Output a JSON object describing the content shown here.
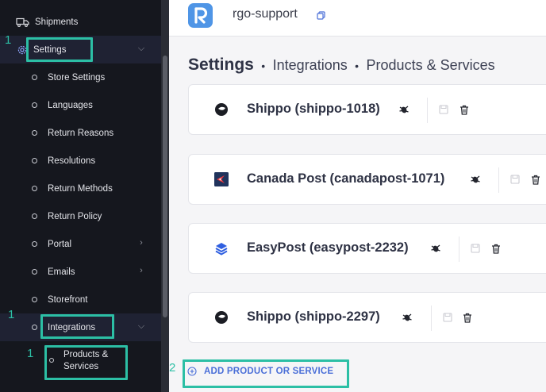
{
  "sidebar": {
    "shipments": "Shipments",
    "settings": "Settings",
    "sub_items": [
      {
        "label": "Store Settings"
      },
      {
        "label": "Languages"
      },
      {
        "label": "Return Reasons"
      },
      {
        "label": "Resolutions"
      },
      {
        "label": "Return Methods"
      },
      {
        "label": "Return Policy"
      },
      {
        "label": "Portal"
      },
      {
        "label": "Emails"
      },
      {
        "label": "Storefront"
      },
      {
        "label": "Integrations"
      }
    ],
    "products_services_line1": "Products &",
    "products_services_line2": "Services"
  },
  "annotations": {
    "step_settings": "1",
    "step_integrations": "1",
    "step_products": "1",
    "step_add": "2",
    "color": "#2cbfa5"
  },
  "topbar": {
    "org_name": "rgo-support"
  },
  "heading": {
    "title": "Settings",
    "sep1": "•",
    "crumb1": "Integrations",
    "sep2": "•",
    "crumb2": "Products & Services"
  },
  "cards": [
    {
      "name": "Shippo (shippo-1018)",
      "icon": "shippo-icon"
    },
    {
      "name": "Canada Post (canadapost-1071)",
      "icon": "canada-post-icon"
    },
    {
      "name": "EasyPost (easypost-2232)",
      "icon": "easypost-icon"
    },
    {
      "name": "Shippo (shippo-2297)",
      "icon": "shippo-icon"
    }
  ],
  "add_button": {
    "label": "ADD PRODUCT OR SERVICE"
  },
  "colors": {
    "sidebar_bg": "#15171e",
    "accent_blue": "#4a6fd8",
    "logo_blue": "#4f95e6",
    "highlight_teal": "#2cbfa5"
  }
}
